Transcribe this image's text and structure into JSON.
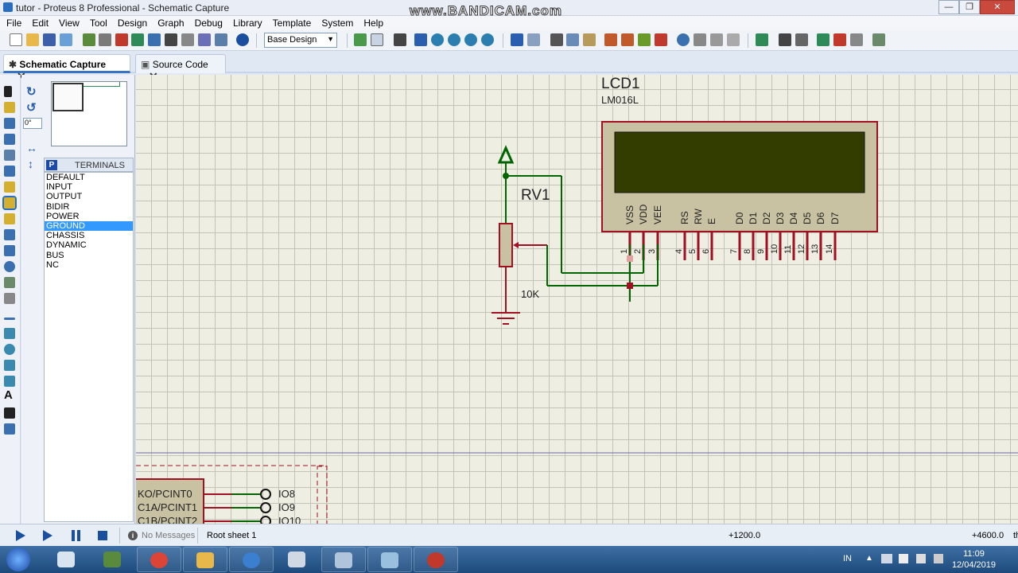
{
  "window": {
    "title": "tutor - Proteus 8 Professional - Schematic Capture",
    "watermark": "www.BANDICAM.com"
  },
  "menu": [
    "File",
    "Edit",
    "View",
    "Tool",
    "Design",
    "Graph",
    "Debug",
    "Library",
    "Template",
    "System",
    "Help"
  ],
  "toolbar": {
    "design_select": "Base Design"
  },
  "tabs": [
    {
      "label": "Schematic Capture",
      "active": true
    },
    {
      "label": "Source Code",
      "active": false
    }
  ],
  "side": {
    "angle": "0°"
  },
  "terminals": {
    "header_letter": "P",
    "header": "TERMINALS",
    "items": [
      "DEFAULT",
      "INPUT",
      "OUTPUT",
      "BIDIR",
      "POWER",
      "GROUND",
      "CHASSIS",
      "DYNAMIC",
      "BUS",
      "NC"
    ],
    "selected": "GROUND"
  },
  "schematic": {
    "lcd": {
      "ref": "LCD1",
      "part": "LM016L",
      "pins": [
        "VSS",
        "VDD",
        "VEE",
        "RS",
        "RW",
        "E",
        "D0",
        "D1",
        "D2",
        "D3",
        "D4",
        "D5",
        "D6",
        "D7"
      ],
      "pin_numbers": [
        "1",
        "2",
        "3",
        "4",
        "5",
        "6",
        "7",
        "8",
        "9",
        "10",
        "11",
        "12",
        "13",
        "14"
      ]
    },
    "pot": {
      "ref": "RV1",
      "value": "10K"
    },
    "mcu_pins": [
      "KO/PCINT0",
      "C1A/PCINT1",
      "C1B/PCINT2"
    ],
    "io_labels": [
      "IO8",
      "IO9",
      "IO10"
    ],
    "colors": {
      "wire": "#006400",
      "pin": "#a01020",
      "lcd_screen": "#333d00",
      "lcd_border": "#a01020"
    }
  },
  "status": {
    "messages": "No Messages",
    "sheet": "Root sheet 1",
    "coord_x": "+1200.0",
    "coord_y": "+4600.0",
    "unit": "th"
  },
  "taskbar": {
    "lang": "IN",
    "time": "11:09",
    "date": "12/04/2019"
  }
}
